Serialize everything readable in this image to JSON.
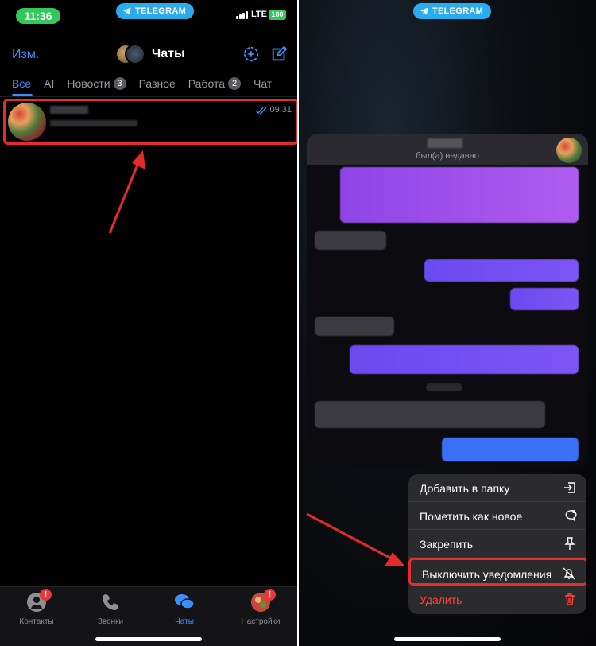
{
  "left_screen": {
    "status": {
      "time": "11:36",
      "telegram": "TELEGRAM",
      "network": "LTE",
      "battery": "100"
    },
    "header": {
      "edit": "Изм.",
      "title": "Чаты"
    },
    "tabs": [
      {
        "label": "Все",
        "count": ""
      },
      {
        "label": "AI",
        "count": ""
      },
      {
        "label": "Новости",
        "count": "3"
      },
      {
        "label": "Разное",
        "count": ""
      },
      {
        "label": "Работа",
        "count": "2"
      },
      {
        "label": "Чат",
        "count": ""
      }
    ],
    "chat": {
      "time": "09:31"
    },
    "tabbar": [
      {
        "label": "Контакты",
        "icon": "person-icon",
        "badge": "!"
      },
      {
        "label": "Звонки",
        "icon": "phone-icon",
        "badge": ""
      },
      {
        "label": "Чаты",
        "icon": "chat-bubbles-icon",
        "badge": ""
      },
      {
        "label": "Настройки",
        "icon": "profile-avatar-icon",
        "badge": "!"
      }
    ]
  },
  "right_screen": {
    "status": {
      "telegram": "TELEGRAM"
    },
    "preview": {
      "status": "был(а) недавно"
    },
    "menu": [
      {
        "label": "Добавить в папку",
        "icon": "folder-add-icon"
      },
      {
        "label": "Пометить как новое",
        "icon": "mark-unread-icon"
      },
      {
        "label": "Закрепить",
        "icon": "pin-icon"
      },
      {
        "label": "Выключить уведомления",
        "icon": "bell-slash-icon"
      },
      {
        "label": "Удалить",
        "icon": "trash-icon"
      }
    ]
  },
  "colors": {
    "accent": "#3e8ef7",
    "highlight": "#e52b2b",
    "danger": "#ff453a",
    "telegram": "#2aabee",
    "status_green": "#34c759"
  }
}
